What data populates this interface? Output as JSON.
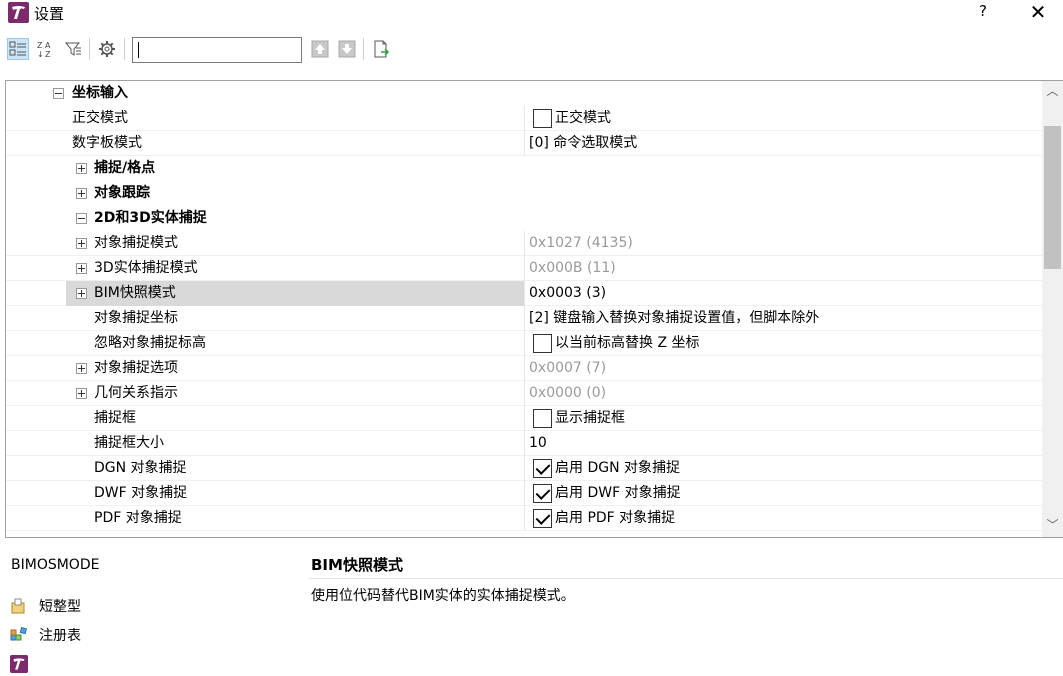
{
  "window": {
    "title": "设置",
    "help": "?",
    "close": "✕"
  },
  "toolbar": {
    "search_value": ""
  },
  "rows": [
    {
      "name": "坐标输入",
      "value": ""
    },
    {
      "name": "正交模式",
      "value": "正交模式"
    },
    {
      "name": "数字板模式",
      "value": "[0] 命令选取模式"
    },
    {
      "name": "捕捉/格点",
      "value": ""
    },
    {
      "name": "对象跟踪",
      "value": ""
    },
    {
      "name": "2D和3D实体捕捉",
      "value": ""
    },
    {
      "name": "对象捕捉模式",
      "value": "0x1027 (4135)"
    },
    {
      "name": "3D实体捕捉模式",
      "value": "0x000B (11)"
    },
    {
      "name": "BIM快照模式",
      "value": "0x0003 (3)"
    },
    {
      "name": "对象捕捉坐标",
      "value": "[2] 键盘输入替换对象捕捉设置值，但脚本除外"
    },
    {
      "name": "忽略对象捕捉标高",
      "value": "以当前标高替换 Z 坐标"
    },
    {
      "name": "对象捕捉选项",
      "value": "0x0007 (7)"
    },
    {
      "name": "几何关系指示",
      "value": "0x0000 (0)"
    },
    {
      "name": "捕捉框",
      "value": "显示捕捉框"
    },
    {
      "name": "捕捉框大小",
      "value": "10"
    },
    {
      "name": "DGN 对象捕捉",
      "value": "启用 DGN 对象捕捉"
    },
    {
      "name": "DWF 对象捕捉",
      "value": "启用 DWF 对象捕捉"
    },
    {
      "name": "PDF 对象捕捉",
      "value": "启用 PDF 对象捕捉"
    }
  ],
  "bottom": {
    "variable": "BIMOSMODE",
    "type_label": "短整型",
    "registry_label": "注册表",
    "desc_title": "BIM快照模式",
    "desc_text": "使用位代码替代BIM实体的实体捕捉模式。"
  },
  "colors": {
    "selected_row": "#d9d9d9",
    "muted_text": "#9a9a9a",
    "toolbar_active": "#cce4f7",
    "logo": "#7b2a6b"
  }
}
